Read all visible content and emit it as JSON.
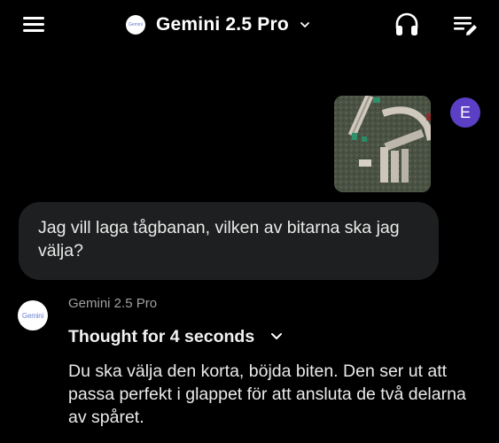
{
  "header": {
    "model_logo_text": "Gemini",
    "model_name": "Gemini 2.5 Pro",
    "icons": {
      "menu": "hamburger-menu-icon",
      "model_dropdown": "chevron-down-icon",
      "audio": "headphones-icon",
      "chats": "list-edit-icon"
    }
  },
  "conversation": {
    "user": {
      "avatar_initial": "E",
      "avatar_color": "#5b3fc4",
      "message": "Jag vill laga tågbanan, vilken av bitarna ska jag välja?"
    },
    "model": {
      "avatar_text": "Gemini",
      "name": "Gemini 2.5 Pro",
      "thought_label": "Thought for 4 seconds",
      "response": "Du ska välja den korta, böjda biten. Den ser ut att passa perfekt i glappet för att ansluta de två delarna av spåret."
    }
  },
  "colors": {
    "background": "#000000",
    "bubble": "#1e1f20",
    "text": "#eaeaea",
    "muted": "#a0a0a0"
  }
}
